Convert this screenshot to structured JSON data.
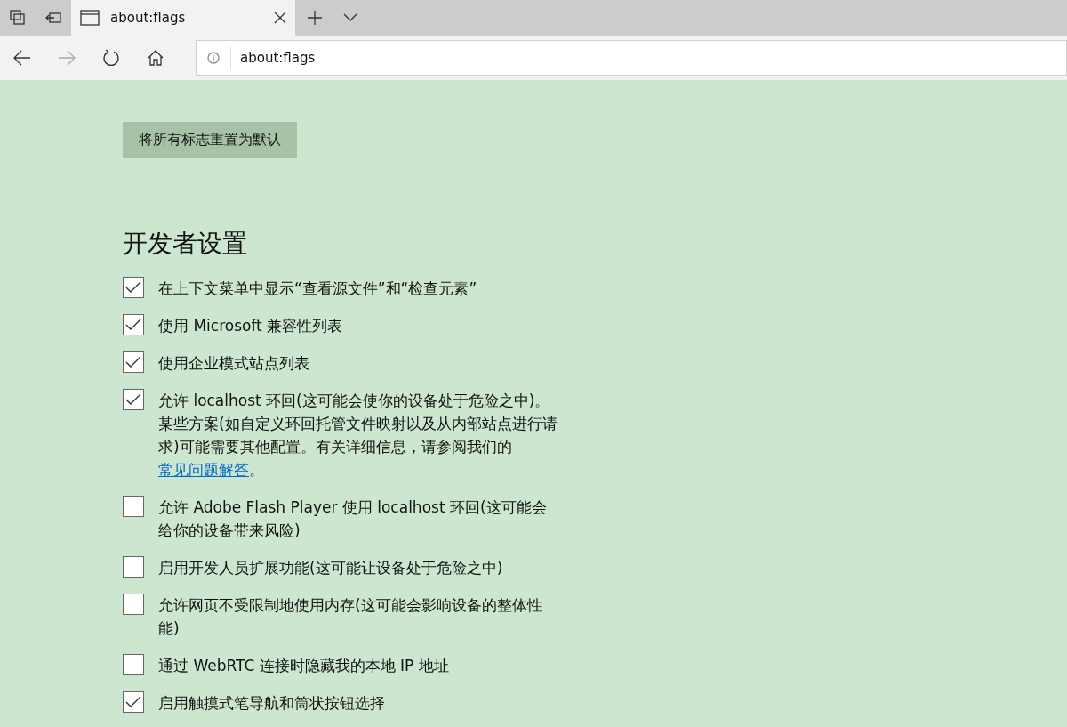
{
  "tabs": [
    {
      "title": "about:flags",
      "selected": true
    }
  ],
  "address_bar": {
    "value": "about:flags"
  },
  "reset_button": {
    "label": "将所有标志重置为默认"
  },
  "section": {
    "heading": "开发者设置",
    "options": [
      {
        "label": "在上下文菜单中显示“查看源文件”和“检查元素”",
        "checked": true
      },
      {
        "label": "使用 Microsoft 兼容性列表",
        "checked": true
      },
      {
        "label": "使用企业模式站点列表",
        "checked": true
      },
      {
        "label": "允许 localhost 环回(这可能会使你的设备处于危险之中)。某些方案(如自定义环回托管文件映射以及从内部站点进行请求)可能需要其他配置。有关详细信息，请参阅我们的",
        "link": "常见问题解答",
        "after": "。",
        "checked": true
      },
      {
        "label": "允许 Adobe Flash Player 使用 localhost 环回(这可能会给你的设备带来风险)",
        "checked": false
      },
      {
        "label": "启用开发人员扩展功能(这可能让设备处于危险之中)",
        "checked": false
      },
      {
        "label": "允许网页不受限制地使用内存(这可能会影响设备的整体性能)",
        "checked": false
      },
      {
        "label": "通过 WebRTC 连接时隐藏我的本地 IP 地址",
        "checked": false
      },
      {
        "label": "启用触摸式笔导航和筒状按钮选择",
        "checked": true
      }
    ]
  }
}
